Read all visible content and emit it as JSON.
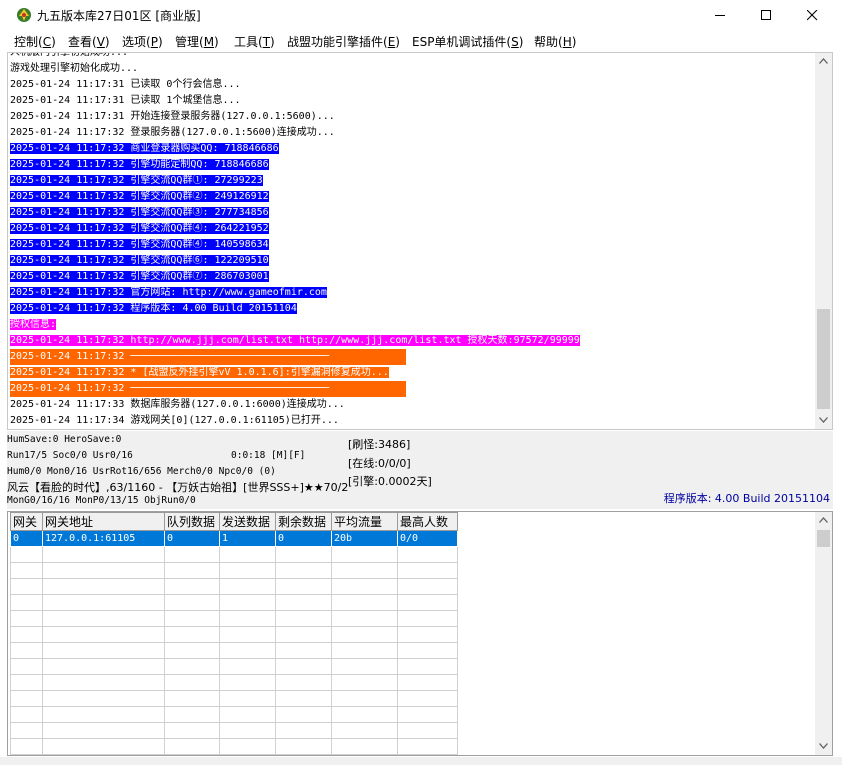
{
  "window": {
    "title": "九五版本库27日01区 [商业版]"
  },
  "menu": [
    {
      "label": "控制(",
      "key": "C",
      "tail": ")"
    },
    {
      "label": "查看(",
      "key": "V",
      "tail": ")"
    },
    {
      "label": "选项(",
      "key": "P",
      "tail": ")"
    },
    {
      "label": "管理(",
      "key": "M",
      "tail": ")"
    },
    {
      "label": "工具(",
      "key": "T",
      "tail": ")"
    },
    {
      "label": "战盟功能引擎插件(",
      "key": "E",
      "tail": ")"
    },
    {
      "label": "ESP单机调试插件(",
      "key": "S",
      "tail": ")"
    },
    {
      "label": "帮助(",
      "key": "H",
      "tail": ")"
    }
  ],
  "log": [
    {
      "text": "人机版门引擎初始成功...",
      "style": "normal"
    },
    {
      "text": "游戏处理引擎初始化成功...",
      "style": "normal"
    },
    {
      "text": "2025-01-24 11:17:31 已读取 0个行会信息...",
      "style": "normal"
    },
    {
      "text": "2025-01-24 11:17:31 已读取 1个城堡信息...",
      "style": "normal"
    },
    {
      "text": "2025-01-24 11:17:31 开始连接登录服务器(127.0.0.1:5600)...",
      "style": "normal"
    },
    {
      "text": "2025-01-24 11:17:32 登录服务器(127.0.0.1:5600)连接成功...",
      "style": "normal"
    },
    {
      "text": "2025-01-24 11:17:32 商业登录器购买QQ: 718846686",
      "style": "blue"
    },
    {
      "text": "2025-01-24 11:17:32 引擎功能定制QQ: 718846686",
      "style": "blue"
    },
    {
      "text": "2025-01-24 11:17:32 引擎交流QQ群①: 27299223",
      "style": "blue"
    },
    {
      "text": "2025-01-24 11:17:32 引擎交流QQ群②: 249126912",
      "style": "blue"
    },
    {
      "text": "2025-01-24 11:17:32 引擎交流QQ群③: 277734856",
      "style": "blue"
    },
    {
      "text": "2025-01-24 11:17:32 引擎交流QQ群④: 264221952",
      "style": "blue"
    },
    {
      "text": "2025-01-24 11:17:32 引擎交流QQ群④: 140598634",
      "style": "blue"
    },
    {
      "text": "2025-01-24 11:17:32 引擎交流QQ群⑥: 122209510",
      "style": "blue"
    },
    {
      "text": "2025-01-24 11:17:32 引擎交流QQ群⑦: 286703001",
      "style": "blue"
    },
    {
      "text": "2025-01-24 11:17:32 官方网站: http://www.gameofmir.com",
      "style": "blue"
    },
    {
      "text": "2025-01-24 11:17:32 程序版本: 4.00 Build 20151104",
      "style": "blue"
    },
    {
      "text": "授权信息:",
      "style": "magenta"
    },
    {
      "text": "2025-01-24 11:17:32 http://www.jjj.com/list.txt http://www.jjj.com/list.txt 授权天数:97572/99999",
      "style": "magenta"
    },
    {
      "text": "2025-01-24 11:17:32 ─────────────────────────────────",
      "style": "orange-full"
    },
    {
      "text": "2025-01-24 11:17:32 * [战盟反外挂引擎vV 1.0.1.6]:引擎漏洞修复成功...",
      "style": "orange"
    },
    {
      "text": "2025-01-24 11:17:32 ─────────────────────────────────",
      "style": "orange-full"
    },
    {
      "text": "2025-01-24 11:17:33 数据库服务器(127.0.0.1:6000)连接成功...",
      "style": "normal"
    },
    {
      "text": "2025-01-24 11:17:34 游戏网关[0](127.0.0.1:61105)已打开...",
      "style": "normal"
    }
  ],
  "status": {
    "line1": "HumSave:0 HeroSave:0",
    "line2": "Run17/5 Soc0/0 Usr0/16",
    "time": "0:0:18 [M][F]",
    "line3": "Hum0/0 Mon0/16 UsrRot16/656 Merch0/0 Npc0/0 (0)",
    "line4": "风云【看脸的时代】,63/1160 - 【万妖古始祖】[世界SSS+]★★70/2",
    "line5": "MonG0/16/16 MonP0/13/15 ObjRun0/0",
    "refresh": "[刷怪:3486]",
    "online": "[在线:0/0/0]",
    "engine": "[引擎:0.0002天]",
    "version": "程序版本: 4.00 Build 20151104"
  },
  "grid": {
    "headers": [
      "网关",
      "网关地址",
      "队列数据",
      "发送数据",
      "剩余数据",
      "平均流量",
      "最高人数"
    ],
    "rows": [
      [
        "0",
        "127.0.0.1:61105",
        "0",
        "1",
        "0",
        "20b",
        "0/0"
      ]
    ],
    "empty_rows": 13
  }
}
